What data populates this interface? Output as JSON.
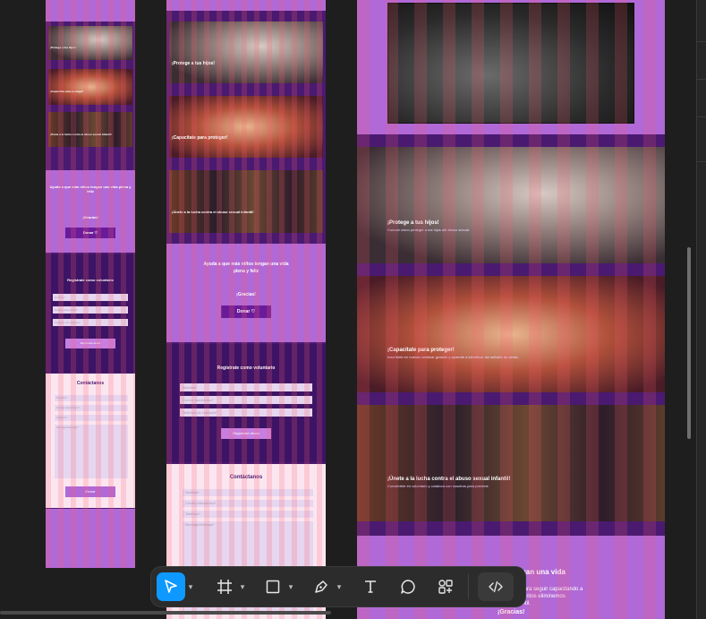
{
  "colors": {
    "canvas": "#1e1e1e",
    "purple": "#b069d6",
    "dark_purple": "#3d1465",
    "band": "#4a1a70",
    "pink_bg": "#fbe6f0",
    "button": "#6a1b9a",
    "toolbar": "#2c2c2c",
    "accent": "#0d99ff"
  },
  "frames": {
    "mobile": {
      "hero1_title": "¡Protege a tus hijos!",
      "hero2_title": "¡Capacítate para proteger!",
      "hero3_title": "¡Únete a la lucha contra el abuso sexual infantil!",
      "donate_heading": "Ayuda a que más niños tengan una vida plena y feliz",
      "donate_thanks": "¡Gracias!",
      "donate_button": "Donar ♡",
      "volunteer_heading": "Regístrate como voluntario",
      "volunteer_fields": [
        "Nombre*",
        "Correo electrónico*",
        "Teléfono de contacto*"
      ],
      "volunteer_button": "Regístrate ahora",
      "contact_heading": "Contáctanos",
      "contact_fields": [
        "Nombre*",
        "Correo electrónico*",
        "Teléfono*",
        "Mensaje/Mensaje*"
      ],
      "contact_button": "Enviar"
    },
    "tablet": {
      "hero1_title": "¡Protege a tus hijos!",
      "hero2_title": "¡Capacítate para proteger!",
      "hero3_title": "¡Únete a la lucha contra el abuso sexual infantil!",
      "donate_heading_1": "Ayuda a que más niños tengan una vida",
      "donate_heading_2": "plena y feliz",
      "donate_thanks": "¡Gracias!",
      "donate_button": "Donar ♡",
      "volunteer_heading": "Regístrate como voluntario",
      "volunteer_fields": [
        "Nombre*",
        "Correo electrónico*",
        "Teléfono de contacto*"
      ],
      "volunteer_button": "Regístrate ahora",
      "contact_heading": "Contáctanos",
      "contact_fields": [
        "Nombre*",
        "Correo electrónico*",
        "Teléfono*",
        "Mensaje/Mensaje*"
      ]
    },
    "desktop": {
      "hero1_title": "¡Protege a tus hijos!",
      "hero1_sub": "Conoce cómo proteger a tus hijos del abuso sexual.",
      "hero2_title": "¡Capacítate para proteger!",
      "hero2_sub": "Inscríbete en nuestro webinar gratuito y aprende a identificar las señales de alerta.",
      "hero3_title": "¡Únete a la lucha contra el abuso sexual infantil!",
      "hero3_sub": "Conviértete en voluntario y colabora con nosotros para prevenir.",
      "donate_heading": "ngan una vida",
      "donate_text_1": "ón para seguir capacitando a",
      "donate_text_2": "a y juntos eliminemos",
      "donate_text_3": "infantil.",
      "donate_thanks": "¡Gracias!"
    }
  },
  "toolbar": {
    "tools": [
      {
        "name": "move-tool",
        "icon": "cursor-icon",
        "active": true
      },
      {
        "name": "frame-tool",
        "icon": "frame-icon"
      },
      {
        "name": "shape-tool",
        "icon": "rectangle-icon"
      },
      {
        "name": "pen-tool",
        "icon": "pen-icon"
      },
      {
        "name": "text-tool",
        "icon": "text-icon"
      },
      {
        "name": "comment-tool",
        "icon": "comment-icon"
      },
      {
        "name": "actions-tool",
        "icon": "actions-icon"
      },
      {
        "name": "dev-mode",
        "icon": "code-icon"
      }
    ]
  }
}
